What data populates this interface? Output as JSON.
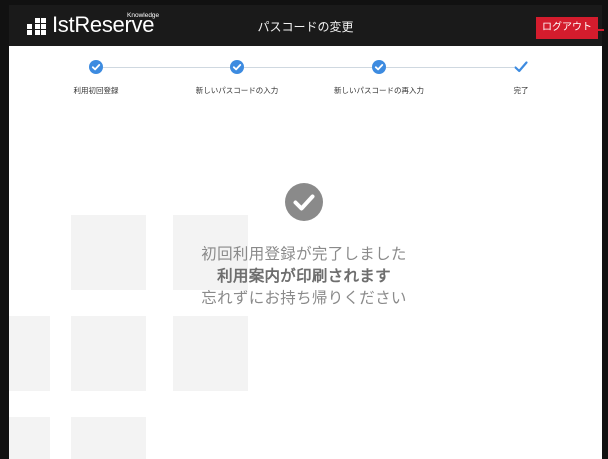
{
  "header": {
    "logo_text": "IstReserve",
    "logo_superscript": "Knowledge",
    "title": "パスコードの変更",
    "logout_label": "ログアウト",
    "bg_color": "#1a1a1a",
    "logout_color": "#d41c2d"
  },
  "stepper": {
    "accent_color": "#3d8be0",
    "steps": [
      {
        "label": "利用初回登録",
        "status": "completed",
        "icon": "check-circle-icon"
      },
      {
        "label": "新しいパスコードの入力",
        "status": "completed",
        "icon": "check-circle-icon"
      },
      {
        "label": "新しいパスコードの再入力",
        "status": "completed",
        "icon": "check-circle-icon"
      },
      {
        "label": "完了",
        "status": "current",
        "icon": "check-icon"
      }
    ]
  },
  "message": {
    "icon": "success-check-icon",
    "line1": "初回利用登録が完了しました",
    "line2": "利用案内が印刷されます",
    "line3": "忘れずにお持ち帰りください"
  }
}
